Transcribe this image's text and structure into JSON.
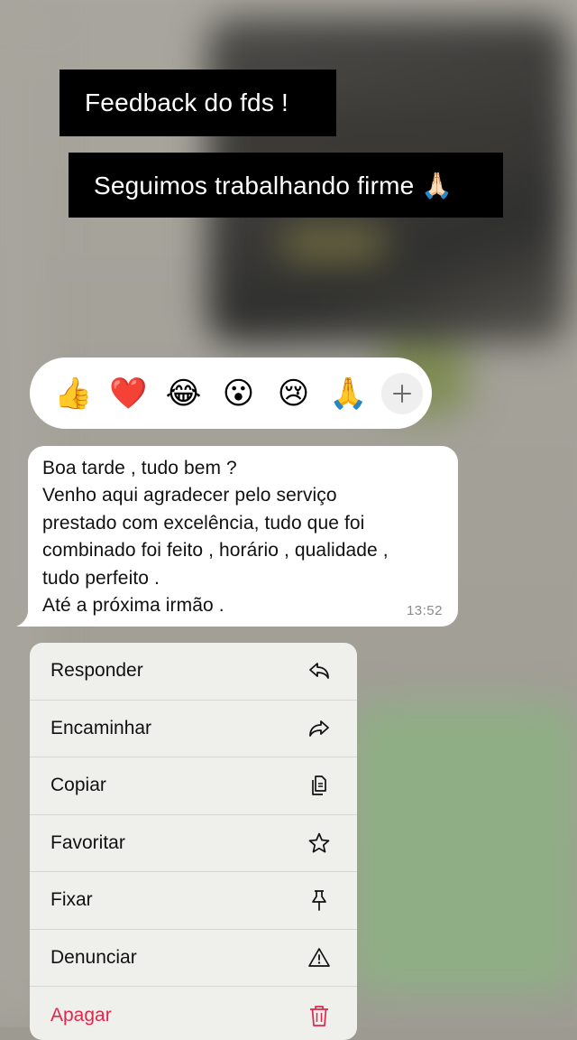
{
  "captions": {
    "line1": "Feedback do fds !",
    "line2": "Seguimos trabalhando firme 🙏🏻"
  },
  "reactions": [
    {
      "emoji": "👍",
      "icon": "thumbs-up-icon"
    },
    {
      "emoji": "❤️",
      "icon": "heart-icon"
    },
    {
      "emoji": "😂",
      "icon": "tears-of-joy-icon"
    },
    {
      "emoji": "😮",
      "icon": "surprised-face-icon"
    },
    {
      "emoji": "😢",
      "icon": "crying-face-icon"
    },
    {
      "emoji": "🙏",
      "icon": "folded-hands-icon"
    }
  ],
  "message": {
    "text": "Boa tarde , tudo bem ?\nVenho aqui agradecer pelo serviço\nprestado com excelência, tudo que foi\ncombinado foi feito , horário , qualidade ,\ntudo perfeito .\nAté a próxima irmão .",
    "time": "13:52"
  },
  "menu": {
    "items": [
      {
        "label": "Responder",
        "icon": "reply-icon"
      },
      {
        "label": "Encaminhar",
        "icon": "forward-icon"
      },
      {
        "label": "Copiar",
        "icon": "copy-icon"
      },
      {
        "label": "Favoritar",
        "icon": "star-icon"
      },
      {
        "label": "Fixar",
        "icon": "pin-icon"
      },
      {
        "label": "Denunciar",
        "icon": "warning-icon"
      },
      {
        "label": "Apagar",
        "icon": "trash-icon"
      }
    ]
  },
  "colors": {
    "danger": "#e0284e",
    "menu_bg": "#efefec",
    "caption_bg": "#000000"
  }
}
